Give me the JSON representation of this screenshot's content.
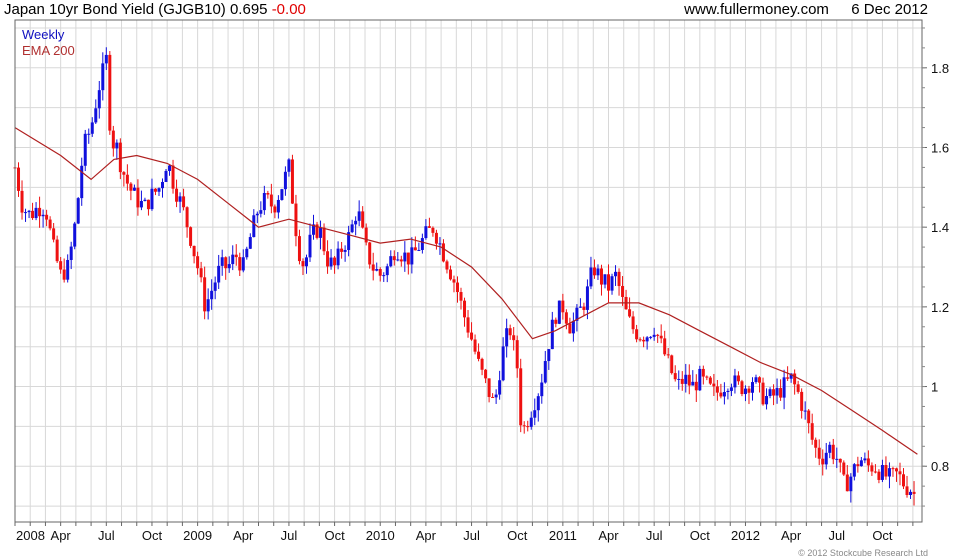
{
  "header": {
    "title": "Japan 10yr Bond Yield (GJGB10)",
    "last": "0.695",
    "change": "-0.00",
    "source": "www.fullermoney.com",
    "date": "6 Dec 2012"
  },
  "legend": {
    "weekly": "Weekly",
    "ema": "EMA 200"
  },
  "copyright": "© 2012 Stockcube Research Ltd",
  "colors": {
    "up": "#1010dd",
    "down": "#ee1111",
    "ema": "#b02020",
    "grid": "#d8d8d8",
    "frame": "#666666"
  },
  "chart_data": {
    "type": "line",
    "title": "Japan 10yr Bond Yield (GJGB10)",
    "frequency": "Weekly",
    "x_range": [
      "2008-01",
      "2012-12"
    ],
    "ylim": [
      0.66,
      1.92
    ],
    "y_ticks": [
      0.8,
      1,
      1.2,
      1.4,
      1.6,
      1.8
    ],
    "y_tick_labels": [
      "0.8",
      "1",
      "1.2",
      "1.4",
      "1.6",
      "1.8"
    ],
    "x_ticks": [
      {
        "m": 0,
        "label": "2008"
      },
      {
        "m": 3,
        "label": "Apr"
      },
      {
        "m": 6,
        "label": "Jul"
      },
      {
        "m": 9,
        "label": "Oct"
      },
      {
        "m": 12,
        "label": "2009"
      },
      {
        "m": 15,
        "label": "Apr"
      },
      {
        "m": 18,
        "label": "Jul"
      },
      {
        "m": 21,
        "label": "Oct"
      },
      {
        "m": 24,
        "label": "2010"
      },
      {
        "m": 27,
        "label": "Apr"
      },
      {
        "m": 30,
        "label": "Jul"
      },
      {
        "m": 33,
        "label": "Oct"
      },
      {
        "m": 36,
        "label": "2011"
      },
      {
        "m": 39,
        "label": "Apr"
      },
      {
        "m": 42,
        "label": "Jul"
      },
      {
        "m": 45,
        "label": "Oct"
      },
      {
        "m": 48,
        "label": "2012"
      },
      {
        "m": 51,
        "label": "Apr"
      },
      {
        "m": 54,
        "label": "Jul"
      },
      {
        "m": 57,
        "label": "Oct"
      }
    ],
    "grid": true,
    "series": [
      {
        "name": "Weekly",
        "style": "candlestick",
        "points": [
          {
            "m": 0,
            "y": 1.55
          },
          {
            "m": 0.5,
            "y": 1.45
          },
          {
            "m": 1,
            "y": 1.43
          },
          {
            "m": 1.5,
            "y": 1.45
          },
          {
            "m": 2,
            "y": 1.45
          },
          {
            "m": 2.5,
            "y": 1.35
          },
          {
            "m": 3,
            "y": 1.28
          },
          {
            "m": 3.5,
            "y": 1.3
          },
          {
            "m": 4,
            "y": 1.42
          },
          {
            "m": 4.5,
            "y": 1.6
          },
          {
            "m": 5,
            "y": 1.65
          },
          {
            "m": 5.5,
            "y": 1.75
          },
          {
            "m": 6,
            "y": 1.82
          },
          {
            "m": 6.3,
            "y": 1.62
          },
          {
            "m": 6.7,
            "y": 1.6
          },
          {
            "m": 7,
            "y": 1.55
          },
          {
            "m": 7.5,
            "y": 1.5
          },
          {
            "m": 8,
            "y": 1.47
          },
          {
            "m": 8.5,
            "y": 1.45
          },
          {
            "m": 9,
            "y": 1.48
          },
          {
            "m": 9.5,
            "y": 1.5
          },
          {
            "m": 10,
            "y": 1.57
          },
          {
            "m": 10.5,
            "y": 1.5
          },
          {
            "m": 11,
            "y": 1.45
          },
          {
            "m": 11.5,
            "y": 1.38
          },
          {
            "m": 12,
            "y": 1.3
          },
          {
            "m": 12.5,
            "y": 1.2
          },
          {
            "m": 13,
            "y": 1.25
          },
          {
            "m": 13.5,
            "y": 1.3
          },
          {
            "m": 14,
            "y": 1.3
          },
          {
            "m": 14.5,
            "y": 1.33
          },
          {
            "m": 15,
            "y": 1.3
          },
          {
            "m": 15.5,
            "y": 1.38
          },
          {
            "m": 16,
            "y": 1.45
          },
          {
            "m": 16.5,
            "y": 1.47
          },
          {
            "m": 17,
            "y": 1.45
          },
          {
            "m": 17.5,
            "y": 1.5
          },
          {
            "m": 18,
            "y": 1.55
          },
          {
            "m": 18.3,
            "y": 1.45
          },
          {
            "m": 18.6,
            "y": 1.35
          },
          {
            "m": 19,
            "y": 1.3
          },
          {
            "m": 19.5,
            "y": 1.38
          },
          {
            "m": 20,
            "y": 1.4
          },
          {
            "m": 20.5,
            "y": 1.32
          },
          {
            "m": 21,
            "y": 1.3
          },
          {
            "m": 21.5,
            "y": 1.35
          },
          {
            "m": 22,
            "y": 1.38
          },
          {
            "m": 22.5,
            "y": 1.45
          },
          {
            "m": 23,
            "y": 1.35
          },
          {
            "m": 23.5,
            "y": 1.3
          },
          {
            "m": 24,
            "y": 1.28
          },
          {
            "m": 24.5,
            "y": 1.3
          },
          {
            "m": 25,
            "y": 1.35
          },
          {
            "m": 25.5,
            "y": 1.33
          },
          {
            "m": 26,
            "y": 1.32
          },
          {
            "m": 26.5,
            "y": 1.35
          },
          {
            "m": 27,
            "y": 1.38
          },
          {
            "m": 27.5,
            "y": 1.4
          },
          {
            "m": 28,
            "y": 1.35
          },
          {
            "m": 28.5,
            "y": 1.3
          },
          {
            "m": 29,
            "y": 1.25
          },
          {
            "m": 29.5,
            "y": 1.18
          },
          {
            "m": 30,
            "y": 1.12
          },
          {
            "m": 30.5,
            "y": 1.05
          },
          {
            "m": 31,
            "y": 1.0
          },
          {
            "m": 31.5,
            "y": 0.95
          },
          {
            "m": 32,
            "y": 1.08
          },
          {
            "m": 32.5,
            "y": 1.15
          },
          {
            "m": 33,
            "y": 1.05
          },
          {
            "m": 33.3,
            "y": 0.88
          },
          {
            "m": 33.7,
            "y": 0.92
          },
          {
            "m": 34,
            "y": 0.95
          },
          {
            "m": 34.5,
            "y": 1.0
          },
          {
            "m": 35,
            "y": 1.1
          },
          {
            "m": 35.5,
            "y": 1.18
          },
          {
            "m": 36,
            "y": 1.2
          },
          {
            "m": 36.5,
            "y": 1.15
          },
          {
            "m": 37,
            "y": 1.18
          },
          {
            "m": 37.5,
            "y": 1.22
          },
          {
            "m": 38,
            "y": 1.3
          },
          {
            "m": 38.5,
            "y": 1.27
          },
          {
            "m": 39,
            "y": 1.25
          },
          {
            "m": 39.5,
            "y": 1.28
          },
          {
            "m": 40,
            "y": 1.2
          },
          {
            "m": 40.5,
            "y": 1.15
          },
          {
            "m": 41,
            "y": 1.13
          },
          {
            "m": 41.5,
            "y": 1.13
          },
          {
            "m": 42,
            "y": 1.15
          },
          {
            "m": 42.5,
            "y": 1.1
          },
          {
            "m": 43,
            "y": 1.05
          },
          {
            "m": 43.5,
            "y": 1.0
          },
          {
            "m": 44,
            "y": 1.02
          },
          {
            "m": 44.5,
            "y": 1.0
          },
          {
            "m": 45,
            "y": 1.02
          },
          {
            "m": 45.5,
            "y": 1.0
          },
          {
            "m": 46,
            "y": 0.98
          },
          {
            "m": 46.5,
            "y": 1.0
          },
          {
            "m": 47,
            "y": 1.02
          },
          {
            "m": 47.5,
            "y": 1.0
          },
          {
            "m": 48,
            "y": 1.0
          },
          {
            "m": 48.5,
            "y": 1.02
          },
          {
            "m": 49,
            "y": 0.98
          },
          {
            "m": 49.5,
            "y": 0.97
          },
          {
            "m": 50,
            "y": 0.98
          },
          {
            "m": 50.5,
            "y": 1.0
          },
          {
            "m": 51,
            "y": 1.02
          },
          {
            "m": 51.5,
            "y": 0.98
          },
          {
            "m": 52,
            "y": 0.92
          },
          {
            "m": 52.5,
            "y": 0.85
          },
          {
            "m": 53,
            "y": 0.82
          },
          {
            "m": 53.5,
            "y": 0.85
          },
          {
            "m": 54,
            "y": 0.82
          },
          {
            "m": 54.5,
            "y": 0.75
          },
          {
            "m": 55,
            "y": 0.78
          },
          {
            "m": 55.5,
            "y": 0.82
          },
          {
            "m": 56,
            "y": 0.8
          },
          {
            "m": 56.5,
            "y": 0.8
          },
          {
            "m": 57,
            "y": 0.78
          },
          {
            "m": 57.5,
            "y": 0.77
          },
          {
            "m": 58,
            "y": 0.78
          },
          {
            "m": 58.5,
            "y": 0.75
          },
          {
            "m": 59,
            "y": 0.74
          },
          {
            "m": 59.3,
            "y": 0.7
          }
        ]
      },
      {
        "name": "EMA 200",
        "style": "line",
        "points": [
          {
            "m": 0,
            "y": 1.65
          },
          {
            "m": 3,
            "y": 1.58
          },
          {
            "m": 5,
            "y": 1.52
          },
          {
            "m": 6.5,
            "y": 1.57
          },
          {
            "m": 8,
            "y": 1.58
          },
          {
            "m": 10,
            "y": 1.56
          },
          {
            "m": 12,
            "y": 1.52
          },
          {
            "m": 14,
            "y": 1.46
          },
          {
            "m": 16,
            "y": 1.4
          },
          {
            "m": 18,
            "y": 1.42
          },
          {
            "m": 20,
            "y": 1.4
          },
          {
            "m": 22,
            "y": 1.38
          },
          {
            "m": 24,
            "y": 1.36
          },
          {
            "m": 26,
            "y": 1.37
          },
          {
            "m": 28,
            "y": 1.35
          },
          {
            "m": 30,
            "y": 1.3
          },
          {
            "m": 32,
            "y": 1.22
          },
          {
            "m": 34,
            "y": 1.12
          },
          {
            "m": 35.5,
            "y": 1.14
          },
          {
            "m": 37,
            "y": 1.17
          },
          {
            "m": 39,
            "y": 1.21
          },
          {
            "m": 41,
            "y": 1.21
          },
          {
            "m": 43,
            "y": 1.18
          },
          {
            "m": 45,
            "y": 1.14
          },
          {
            "m": 47,
            "y": 1.1
          },
          {
            "m": 49,
            "y": 1.06
          },
          {
            "m": 51,
            "y": 1.03
          },
          {
            "m": 53,
            "y": 0.99
          },
          {
            "m": 55,
            "y": 0.94
          },
          {
            "m": 57,
            "y": 0.89
          },
          {
            "m": 59.3,
            "y": 0.83
          }
        ]
      }
    ]
  }
}
